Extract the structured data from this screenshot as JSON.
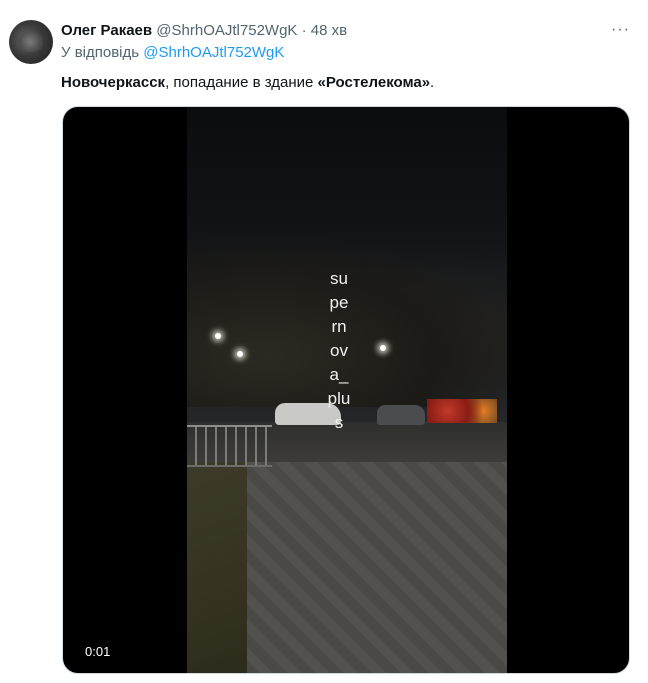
{
  "tweet": {
    "author_name": "Олег Ракаев",
    "handle": "@ShrhOAJtl752WgK",
    "separator": "·",
    "time": "48 хв",
    "more_icon": "more-horizontal-icon",
    "reply_prefix": "У відповідь",
    "reply_handle": "@ShrhOAJtl752WgK",
    "text_bold_1": "Новочеркасск",
    "text_mid": ", попадание в здание ",
    "text_bold_2": "«Ростелекома»",
    "text_end": "."
  },
  "video": {
    "watermark": "supernova_plus",
    "elapsed": "0:01"
  }
}
